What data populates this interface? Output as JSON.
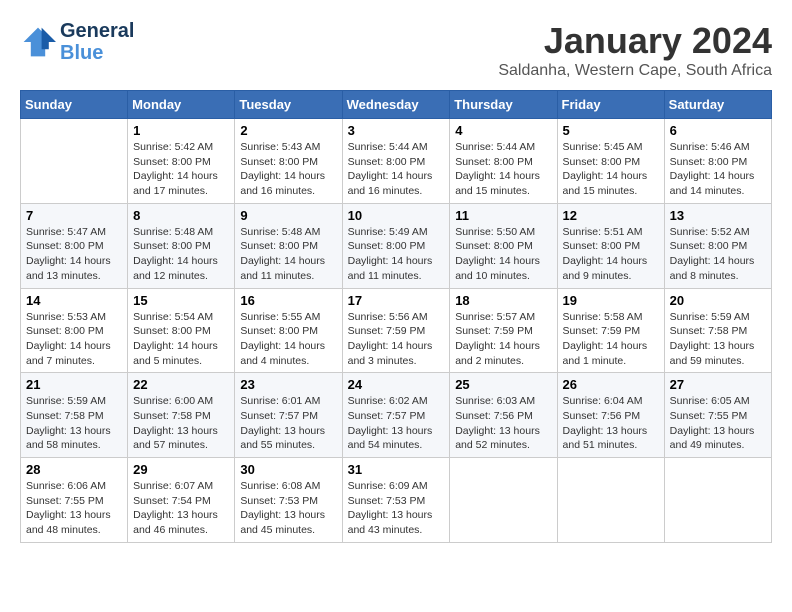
{
  "header": {
    "logo_line1": "General",
    "logo_line2": "Blue",
    "month": "January 2024",
    "location": "Saldanha, Western Cape, South Africa"
  },
  "weekdays": [
    "Sunday",
    "Monday",
    "Tuesday",
    "Wednesday",
    "Thursday",
    "Friday",
    "Saturday"
  ],
  "weeks": [
    [
      {
        "day": "",
        "sunrise": "",
        "sunset": "",
        "daylight": ""
      },
      {
        "day": "1",
        "sunrise": "Sunrise: 5:42 AM",
        "sunset": "Sunset: 8:00 PM",
        "daylight": "Daylight: 14 hours and 17 minutes."
      },
      {
        "day": "2",
        "sunrise": "Sunrise: 5:43 AM",
        "sunset": "Sunset: 8:00 PM",
        "daylight": "Daylight: 14 hours and 16 minutes."
      },
      {
        "day": "3",
        "sunrise": "Sunrise: 5:44 AM",
        "sunset": "Sunset: 8:00 PM",
        "daylight": "Daylight: 14 hours and 16 minutes."
      },
      {
        "day": "4",
        "sunrise": "Sunrise: 5:44 AM",
        "sunset": "Sunset: 8:00 PM",
        "daylight": "Daylight: 14 hours and 15 minutes."
      },
      {
        "day": "5",
        "sunrise": "Sunrise: 5:45 AM",
        "sunset": "Sunset: 8:00 PM",
        "daylight": "Daylight: 14 hours and 15 minutes."
      },
      {
        "day": "6",
        "sunrise": "Sunrise: 5:46 AM",
        "sunset": "Sunset: 8:00 PM",
        "daylight": "Daylight: 14 hours and 14 minutes."
      }
    ],
    [
      {
        "day": "7",
        "sunrise": "Sunrise: 5:47 AM",
        "sunset": "Sunset: 8:00 PM",
        "daylight": "Daylight: 14 hours and 13 minutes."
      },
      {
        "day": "8",
        "sunrise": "Sunrise: 5:48 AM",
        "sunset": "Sunset: 8:00 PM",
        "daylight": "Daylight: 14 hours and 12 minutes."
      },
      {
        "day": "9",
        "sunrise": "Sunrise: 5:48 AM",
        "sunset": "Sunset: 8:00 PM",
        "daylight": "Daylight: 14 hours and 11 minutes."
      },
      {
        "day": "10",
        "sunrise": "Sunrise: 5:49 AM",
        "sunset": "Sunset: 8:00 PM",
        "daylight": "Daylight: 14 hours and 11 minutes."
      },
      {
        "day": "11",
        "sunrise": "Sunrise: 5:50 AM",
        "sunset": "Sunset: 8:00 PM",
        "daylight": "Daylight: 14 hours and 10 minutes."
      },
      {
        "day": "12",
        "sunrise": "Sunrise: 5:51 AM",
        "sunset": "Sunset: 8:00 PM",
        "daylight": "Daylight: 14 hours and 9 minutes."
      },
      {
        "day": "13",
        "sunrise": "Sunrise: 5:52 AM",
        "sunset": "Sunset: 8:00 PM",
        "daylight": "Daylight: 14 hours and 8 minutes."
      }
    ],
    [
      {
        "day": "14",
        "sunrise": "Sunrise: 5:53 AM",
        "sunset": "Sunset: 8:00 PM",
        "daylight": "Daylight: 14 hours and 7 minutes."
      },
      {
        "day": "15",
        "sunrise": "Sunrise: 5:54 AM",
        "sunset": "Sunset: 8:00 PM",
        "daylight": "Daylight: 14 hours and 5 minutes."
      },
      {
        "day": "16",
        "sunrise": "Sunrise: 5:55 AM",
        "sunset": "Sunset: 8:00 PM",
        "daylight": "Daylight: 14 hours and 4 minutes."
      },
      {
        "day": "17",
        "sunrise": "Sunrise: 5:56 AM",
        "sunset": "Sunset: 7:59 PM",
        "daylight": "Daylight: 14 hours and 3 minutes."
      },
      {
        "day": "18",
        "sunrise": "Sunrise: 5:57 AM",
        "sunset": "Sunset: 7:59 PM",
        "daylight": "Daylight: 14 hours and 2 minutes."
      },
      {
        "day": "19",
        "sunrise": "Sunrise: 5:58 AM",
        "sunset": "Sunset: 7:59 PM",
        "daylight": "Daylight: 14 hours and 1 minute."
      },
      {
        "day": "20",
        "sunrise": "Sunrise: 5:59 AM",
        "sunset": "Sunset: 7:58 PM",
        "daylight": "Daylight: 13 hours and 59 minutes."
      }
    ],
    [
      {
        "day": "21",
        "sunrise": "Sunrise: 5:59 AM",
        "sunset": "Sunset: 7:58 PM",
        "daylight": "Daylight: 13 hours and 58 minutes."
      },
      {
        "day": "22",
        "sunrise": "Sunrise: 6:00 AM",
        "sunset": "Sunset: 7:58 PM",
        "daylight": "Daylight: 13 hours and 57 minutes."
      },
      {
        "day": "23",
        "sunrise": "Sunrise: 6:01 AM",
        "sunset": "Sunset: 7:57 PM",
        "daylight": "Daylight: 13 hours and 55 minutes."
      },
      {
        "day": "24",
        "sunrise": "Sunrise: 6:02 AM",
        "sunset": "Sunset: 7:57 PM",
        "daylight": "Daylight: 13 hours and 54 minutes."
      },
      {
        "day": "25",
        "sunrise": "Sunrise: 6:03 AM",
        "sunset": "Sunset: 7:56 PM",
        "daylight": "Daylight: 13 hours and 52 minutes."
      },
      {
        "day": "26",
        "sunrise": "Sunrise: 6:04 AM",
        "sunset": "Sunset: 7:56 PM",
        "daylight": "Daylight: 13 hours and 51 minutes."
      },
      {
        "day": "27",
        "sunrise": "Sunrise: 6:05 AM",
        "sunset": "Sunset: 7:55 PM",
        "daylight": "Daylight: 13 hours and 49 minutes."
      }
    ],
    [
      {
        "day": "28",
        "sunrise": "Sunrise: 6:06 AM",
        "sunset": "Sunset: 7:55 PM",
        "daylight": "Daylight: 13 hours and 48 minutes."
      },
      {
        "day": "29",
        "sunrise": "Sunrise: 6:07 AM",
        "sunset": "Sunset: 7:54 PM",
        "daylight": "Daylight: 13 hours and 46 minutes."
      },
      {
        "day": "30",
        "sunrise": "Sunrise: 6:08 AM",
        "sunset": "Sunset: 7:53 PM",
        "daylight": "Daylight: 13 hours and 45 minutes."
      },
      {
        "day": "31",
        "sunrise": "Sunrise: 6:09 AM",
        "sunset": "Sunset: 7:53 PM",
        "daylight": "Daylight: 13 hours and 43 minutes."
      },
      {
        "day": "",
        "sunrise": "",
        "sunset": "",
        "daylight": ""
      },
      {
        "day": "",
        "sunrise": "",
        "sunset": "",
        "daylight": ""
      },
      {
        "day": "",
        "sunrise": "",
        "sunset": "",
        "daylight": ""
      }
    ]
  ]
}
